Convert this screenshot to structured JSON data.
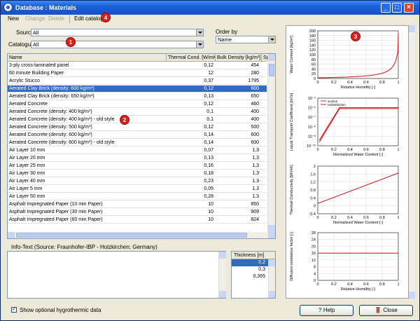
{
  "window": {
    "title": "Database : Materials"
  },
  "menu": {
    "new": "New",
    "change": "Change",
    "delete": "Delete",
    "edit_catalog": "Edit catalog"
  },
  "filters": {
    "source_label": "Source",
    "source_value": "All",
    "catalogue_label": "Catalogue",
    "catalogue_value": "All",
    "order_label": "Order by",
    "order_value": "Name"
  },
  "table": {
    "headers": [
      "Name",
      "Thermal Cond. [W/mK]",
      "Bulk Density [kg/m³]",
      "Spe"
    ],
    "rows": [
      [
        "3-ply cross-laminated panel",
        "0,12",
        "454"
      ],
      [
        "60 minute Building Paper",
        "12",
        "280"
      ],
      [
        "Acrylic Stucco",
        "0,37",
        "1795"
      ],
      [
        "Aerated Clay Brick (density: 600 kg/m³)",
        "0,12",
        "600"
      ],
      [
        "Aerated Clay Brick (density: 650 kg/m³)",
        "0,13",
        "650"
      ],
      [
        "Aerated Concrete",
        "0,12",
        "460"
      ],
      [
        "Aerated Concrete (density: 400 kg/m³)",
        "0,1",
        "400"
      ],
      [
        "Aerated Concrete (density: 400 kg/m³) - old style",
        "0,1",
        "400"
      ],
      [
        "Aerated Concrete (density: 500 kg/m³)",
        "0,12",
        "500"
      ],
      [
        "Aerated Concrete (density: 600 kg/m³)",
        "0,14",
        "600"
      ],
      [
        "Aerated Concrete (density: 600 kg/m³) - old style",
        "0,14",
        "600"
      ],
      [
        "Air Layer 10 mm",
        "0,07",
        "1,3"
      ],
      [
        "Air Layer 20 mm",
        "0,13",
        "1,3"
      ],
      [
        "Air Layer 25 mm",
        "0,16",
        "1,3"
      ],
      [
        "Air Layer 30 mm",
        "0,18",
        "1,3"
      ],
      [
        "Air Layer 40 mm",
        "0,23",
        "1,3"
      ],
      [
        "Air Layer 5 mm",
        "0,05",
        "1,3"
      ],
      [
        "Air Layer 50 mm",
        "0,28",
        "1,3"
      ],
      [
        "Asphalt Impregnated Paper (10 min Paper)",
        "10",
        "850"
      ],
      [
        "Asphalt Impregnated Paper (30 min Paper)",
        "10",
        "909"
      ],
      [
        "Asphalt Impregnated Paper (60 min Paper)",
        "10",
        "824"
      ]
    ],
    "selected_index": 3
  },
  "info": {
    "label": "Info-Text  (Source: Fraunhofer-IBP - Holzkirchen; Germany)"
  },
  "thickness": {
    "header": "Thickness [m]",
    "values": [
      "0,2",
      "0,3",
      "0,365"
    ],
    "selected_index": 0
  },
  "options": {
    "show_hygro_label": "Show optional hygrothermic data",
    "show_hygro_checked": true
  },
  "buttons": {
    "help": "Help",
    "close": "Close"
  },
  "markers": [
    "1",
    "2",
    "3",
    "4"
  ],
  "charts": {
    "c1": {
      "ylabel": "Water Content [kg/m³]",
      "xlabel": "Relative Humidity [-]",
      "yticks": [
        "200",
        "180",
        "160",
        "140",
        "120",
        "100",
        "80",
        "60",
        "40",
        "20",
        "0"
      ],
      "xticks": [
        "0",
        "0.2",
        "0.4",
        "0.6",
        "0.8",
        "1"
      ]
    },
    "c2": {
      "ylabel": "Liquid Transport Coefficient [m²/s]",
      "xlabel": "Normalized Water Content [-]",
      "legend": [
        "suction",
        "redistribution"
      ],
      "yticks": [
        "10⁻⁵",
        "10⁻⁶",
        "10⁻⁷",
        "10⁻⁸",
        "10⁻⁹",
        "10⁻¹⁰"
      ],
      "xticks": [
        "0",
        "0.2",
        "0.4",
        "0.6",
        "0.8",
        "1"
      ]
    },
    "c3": {
      "ylabel": "Thermal Conductivity [W/mK]",
      "xlabel": "Normalized Water Content [-]",
      "yticks": [
        "2",
        "1.6",
        "1.2",
        "0.8",
        "0.4",
        "0",
        "-0.4"
      ],
      "xticks": [
        "0",
        "0.2",
        "0.4",
        "0.6",
        "0.8",
        "1"
      ]
    },
    "c4": {
      "ylabel": "Diffusion resistance factor [-]",
      "xlabel": "Relative Humidity [-]",
      "yticks": [
        "28",
        "24",
        "20",
        "16",
        "12",
        "8",
        "4",
        "0"
      ],
      "xticks": [
        "0",
        "0.2",
        "0.4",
        "0.6",
        "0.8",
        "1"
      ]
    }
  },
  "colors": {
    "selection": "#316ac5",
    "curve": "#d42020",
    "titlebar": "#1c5fd6"
  }
}
